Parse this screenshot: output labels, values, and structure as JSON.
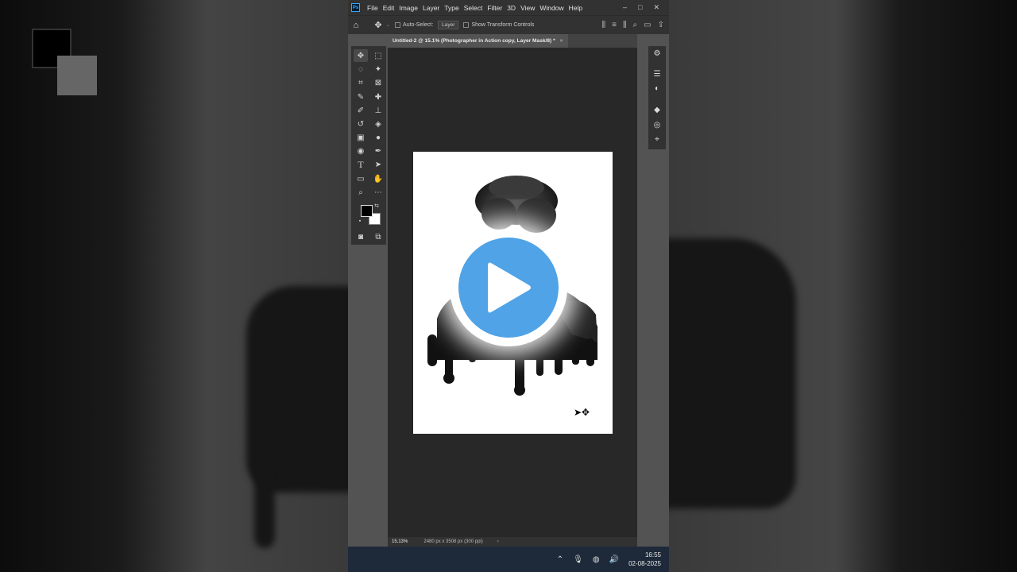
{
  "menubar": {
    "logo": "Ps",
    "items": [
      "File",
      "Edit",
      "Image",
      "Layer",
      "Type",
      "Select",
      "Filter",
      "3D",
      "View",
      "Window",
      "Help"
    ],
    "window_controls": [
      "–",
      "□",
      "✕"
    ]
  },
  "options": {
    "auto_select_label": "Auto-Select:",
    "auto_select_value": "Layer",
    "transform_label": "Show Transform Controls"
  },
  "document": {
    "tab_title": "Untitled-2 @ 15.1% (Photographer in Action copy, Layer Mask/8) *",
    "close": "×"
  },
  "status": {
    "zoom": "15.13%",
    "dimensions": "2480 px x 3508 px (300 ppi)",
    "arrow": "›"
  },
  "taskbar": {
    "time": "16:55",
    "date": "02-08-2025"
  },
  "colors": {
    "play_accent": "#4fa3e6",
    "ps_blue": "#31a8ff"
  },
  "icons": {
    "home": "home-icon",
    "move": "move-tool-icon",
    "play": "play-icon"
  }
}
